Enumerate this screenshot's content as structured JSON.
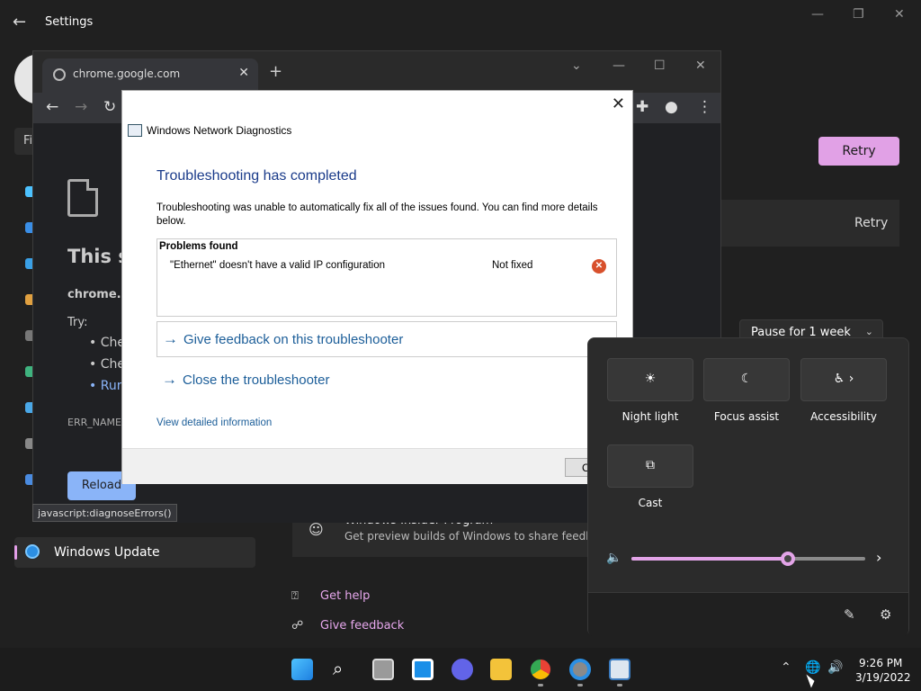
{
  "settings": {
    "title": "Settings",
    "find_placeholder": "Fi",
    "windows_update_label": "Windows Update",
    "retry_primary": "Retry",
    "retry_secondary": "Retry",
    "pause_label": "Pause for 1 week",
    "insider_title": "Windows Insider Program",
    "insider_subtitle": "Get preview builds of Windows to share feedback",
    "get_help": "Get help",
    "give_feedback": "Give feedback",
    "accent_color": "#e1a1e6"
  },
  "chrome": {
    "tab_title": "chrome.google.com",
    "error_title": "This si",
    "error_host": "chrome.g",
    "try_label": "Try:",
    "suggestions": [
      "Che",
      "Che",
      "Run"
    ],
    "error_code": "ERR_NAME",
    "reload_label": "Reload",
    "status_url": "javascript:diagnoseErrors()"
  },
  "dialog": {
    "title": "Windows Network Diagnostics",
    "heading": "Troubleshooting has completed",
    "description": "Troubleshooting was unable to automatically fix all of the issues found. You can find more details below.",
    "problems_header": "Problems found",
    "problems": [
      {
        "name": "\"Ethernet\" doesn't have a valid IP configuration",
        "status": "Not fixed"
      }
    ],
    "feedback_link": "Give feedback on this troubleshooter",
    "close_link": "Close the troubleshooter",
    "details_link": "View detailed information",
    "close_button": "C",
    "heading_color": "#1a3b8a",
    "link_color": "#1c5e99"
  },
  "quick_settings": {
    "tiles": [
      {
        "label": "Night light",
        "icon": "night-light-icon"
      },
      {
        "label": "Focus assist",
        "icon": "focus-assist-icon"
      },
      {
        "label": "Accessibility",
        "icon": "accessibility-icon"
      },
      {
        "label": "Cast",
        "icon": "cast-icon"
      }
    ],
    "volume_percent": 67
  },
  "taskbar": {
    "time": "9:26 PM",
    "date": "3/19/2022"
  }
}
